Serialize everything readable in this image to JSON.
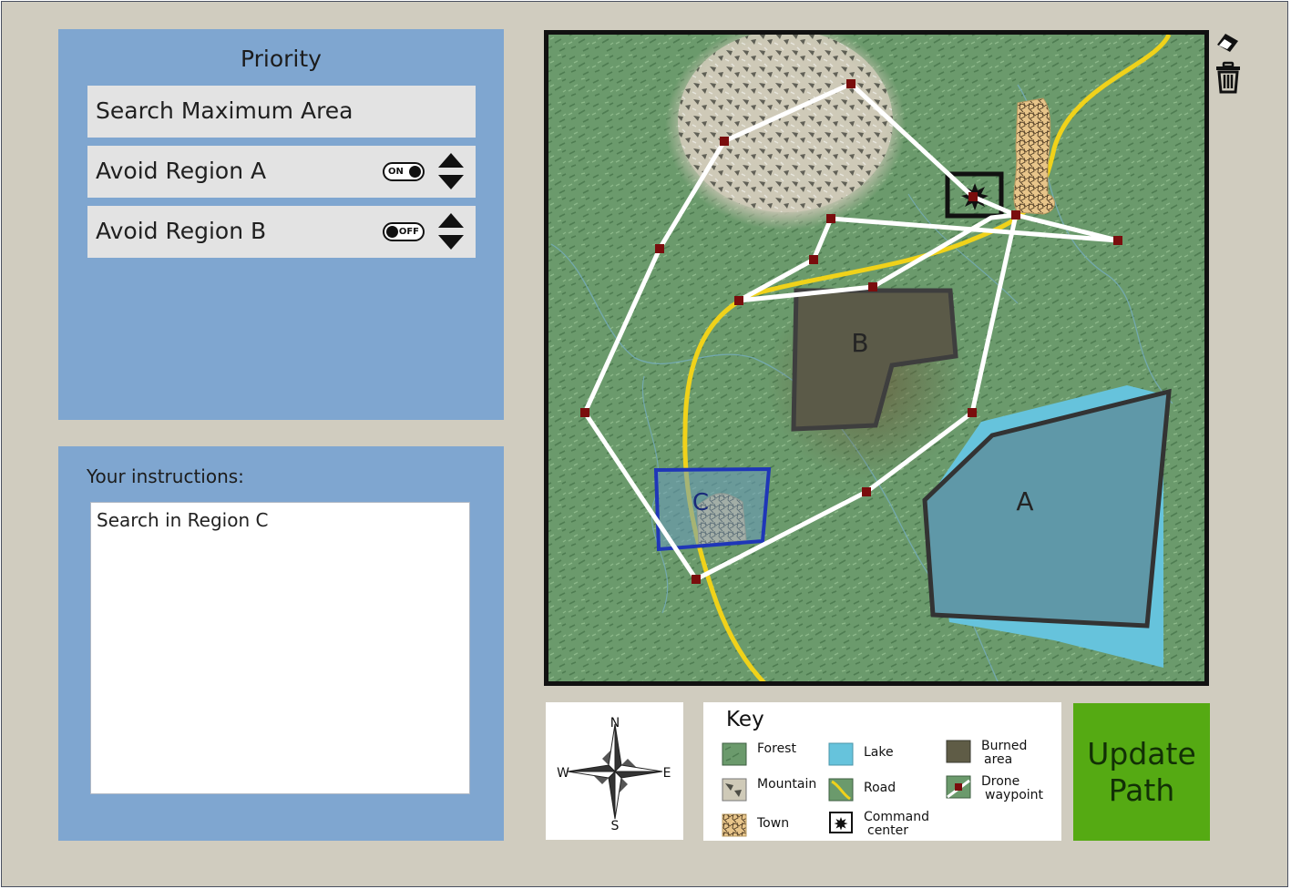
{
  "priority": {
    "title": "Priority",
    "items": [
      {
        "label": "Search Maximum Area"
      },
      {
        "label": "Avoid Region A",
        "toggle": "ON"
      },
      {
        "label": "Avoid Region B",
        "toggle": "OFF"
      }
    ]
  },
  "instructions": {
    "label": "Your instructions:",
    "value": "Search in Region C"
  },
  "map": {
    "region_labels": {
      "a": "A",
      "b": "B",
      "c": "C"
    },
    "icons": [
      "forest-texture",
      "mountain",
      "town",
      "lake",
      "burned-area",
      "road",
      "command-center",
      "drone-waypoint",
      "flight-path",
      "region-selection"
    ]
  },
  "tools": {
    "eraser": "eraser-icon",
    "trash": "trash-icon"
  },
  "compass": {
    "n": "N",
    "s": "S",
    "e": "E",
    "w": "W"
  },
  "key": {
    "title": "Key",
    "items": {
      "forest": "Forest",
      "mountain": "Mountain",
      "town": "Town",
      "lake": "Lake",
      "road": "Road",
      "command_l1": "Command",
      "command_l2": "center",
      "burned_l1": "Burned",
      "burned_l2": "area",
      "drone_l1": "Drone",
      "drone_l2": "waypoint"
    }
  },
  "update_button": {
    "line1": "Update",
    "line2": "Path"
  },
  "colors": {
    "background": "#d0ccbf",
    "panel": "#7fa6d0",
    "row": "#e3e3e3",
    "forest": "#6b9a6c",
    "lake": "#60a0b0",
    "burned": "#5b5a48",
    "road": "#f0d21a",
    "waypoint": "#7a0d0d",
    "path": "#ffffff",
    "region_c_border": "#1f36b8",
    "update_button": "#55aa13"
  }
}
